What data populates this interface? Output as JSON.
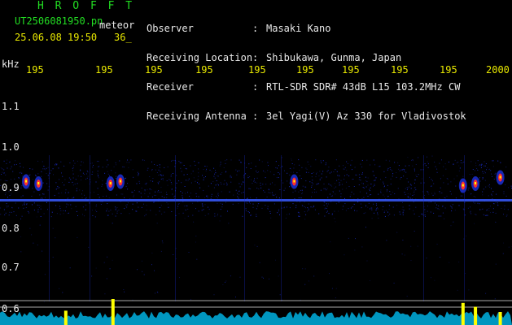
{
  "app": {
    "title": "H R O F F T",
    "filename": "UT2506081950.pn",
    "meteor_tag": "meteor",
    "datetime": "25.06.08 19:50",
    "count": "36_"
  },
  "header": {
    "labels": [
      "Observer",
      "Receiving Location",
      "Receiver",
      "Receiving Antenna"
    ],
    "colons": [
      ":",
      ":",
      ":",
      ":"
    ],
    "values": [
      "Masaki Kano",
      "Shibukawa, Gunma, Japan",
      "RTL-SDR SDR# 43dB L15 103.2MHz CW",
      "3el Yagi(V) Az 330 for Vladivostok"
    ]
  },
  "chart_data": {
    "type": "heatmap",
    "ylabel": "kHz",
    "x_ticks": [
      "195",
      "195",
      "195",
      "195",
      "195",
      "195",
      "195",
      "195",
      "195",
      "2000"
    ],
    "y_ticks": [
      "1.1",
      "1.0",
      "0.9",
      "0.8",
      "0.7",
      "0.6"
    ],
    "y_values": [
      1.1,
      1.0,
      0.9,
      0.8,
      0.7,
      0.6
    ],
    "ylim": [
      0.58,
      1.19
    ],
    "signal_band_khz": [
      0.87,
      0.93
    ],
    "carrier_khz": 0.87,
    "colors": {
      "background": "#000000",
      "noise": "#1a2cc8",
      "carrier": "#3a5cff",
      "echo": "#ff3030",
      "hot": "#ffff00",
      "gridline": "#aaaaaa",
      "bars": "#ffff00",
      "noise_floor": "#00c8ff"
    },
    "echoes": [
      {
        "time": 1950.2,
        "khz": 0.915
      },
      {
        "time": 1950.45,
        "khz": 0.91
      },
      {
        "time": 1951.9,
        "khz": 0.91
      },
      {
        "time": 1952.1,
        "khz": 0.915
      },
      {
        "time": 1955.6,
        "khz": 0.915
      },
      {
        "time": 1959.0,
        "khz": 0.905
      },
      {
        "time": 1959.25,
        "khz": 0.91
      },
      {
        "time": 1959.75,
        "khz": 0.925
      }
    ],
    "spikes": [
      {
        "time": 1951.0,
        "level": 0.55
      },
      {
        "time": 1951.95,
        "level": 1.0
      },
      {
        "time": 1959.0,
        "level": 0.85
      },
      {
        "time": 1959.25,
        "level": 0.7
      },
      {
        "time": 1959.75,
        "level": 0.5
      }
    ]
  }
}
